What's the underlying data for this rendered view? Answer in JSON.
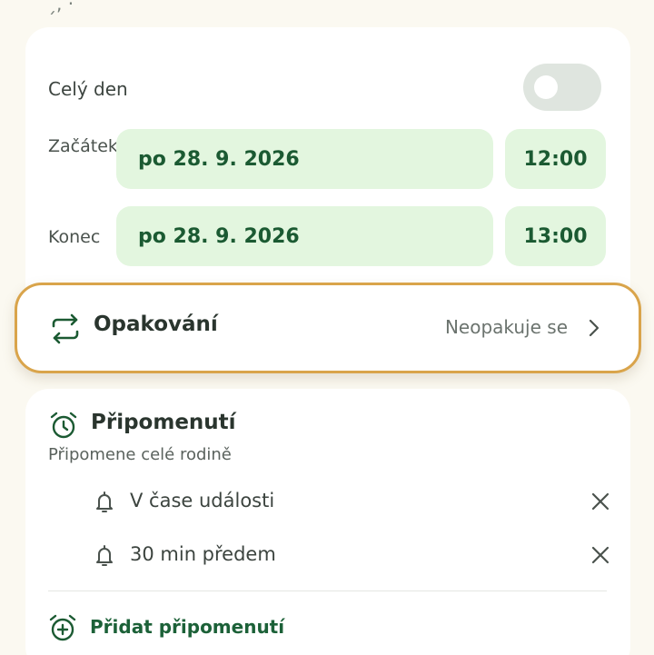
{
  "top_partial_text": "ˏ, ·",
  "time_section": {
    "all_day_label": "Celý den",
    "all_day_on": false,
    "start_label": "Začátek",
    "start_date": "po 28. 9. 2026",
    "start_time": "12:00",
    "end_label": "Konec",
    "end_date": "po 28. 9. 2026",
    "end_time": "13:00"
  },
  "repeat": {
    "title": "Opakování",
    "value": "Neopakuje se"
  },
  "reminders": {
    "title": "Připomenutí",
    "subtitle": "Připomene celé rodině",
    "items": [
      {
        "label": "V čase události"
      },
      {
        "label": "30 min předem"
      }
    ],
    "add_label": "Přidat připomenutí"
  },
  "colors": {
    "accent_green": "#1b5a32",
    "pill_bg": "#e3f6df",
    "highlight_border": "#d9a44b",
    "background": "#fbf9f1"
  },
  "icons": {
    "repeat": "repeat-icon",
    "chevron": "chevron-right-icon",
    "alarm": "alarm-clock-icon",
    "bell": "bell-icon",
    "remove": "close-icon",
    "add_alarm": "alarm-add-icon"
  }
}
